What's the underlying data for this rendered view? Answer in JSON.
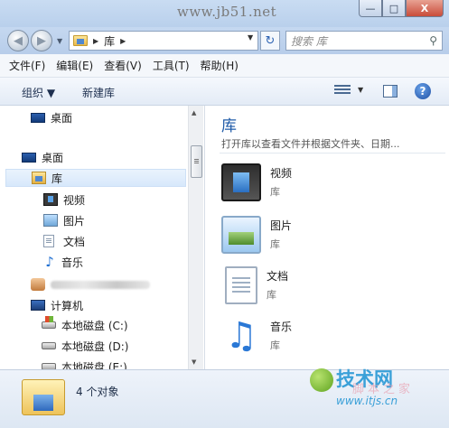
{
  "watermark_top": "www.jb51.net",
  "window_controls": {
    "minimize": "—",
    "maximize": "□",
    "close": "X"
  },
  "address": {
    "path": "库",
    "search_placeholder": "搜索 库"
  },
  "menu": [
    "文件(F)",
    "编辑(E)",
    "查看(V)",
    "工具(T)",
    "帮助(H)"
  ],
  "toolbar": {
    "organize": "组织 ▼",
    "new_library": "新建库",
    "help": "?"
  },
  "navpane": {
    "desktop_top": "桌面",
    "desktop": "桌面",
    "libraries": "库",
    "lib_items": [
      "视频",
      "图片",
      "文档",
      "音乐"
    ],
    "computer": "计算机",
    "drives": [
      "本地磁盘 (C:)",
      "本地磁盘 (D:)",
      "本地磁盘 (E:)"
    ]
  },
  "content": {
    "title": "库",
    "subtitle": "打开库以查看文件并根据文件夹、日期...",
    "items": [
      {
        "name": "视频",
        "type": "库",
        "icon": "video-library-icon"
      },
      {
        "name": "图片",
        "type": "库",
        "icon": "pictures-library-icon"
      },
      {
        "name": "文档",
        "type": "库",
        "icon": "documents-library-icon"
      },
      {
        "name": "音乐",
        "type": "库",
        "icon": "music-library-icon"
      }
    ]
  },
  "status": {
    "count": "4 个对象"
  },
  "watermark_bottom": {
    "logo": "技术网",
    "url": "www.itjs.cn",
    "faint": "脚本之家"
  }
}
